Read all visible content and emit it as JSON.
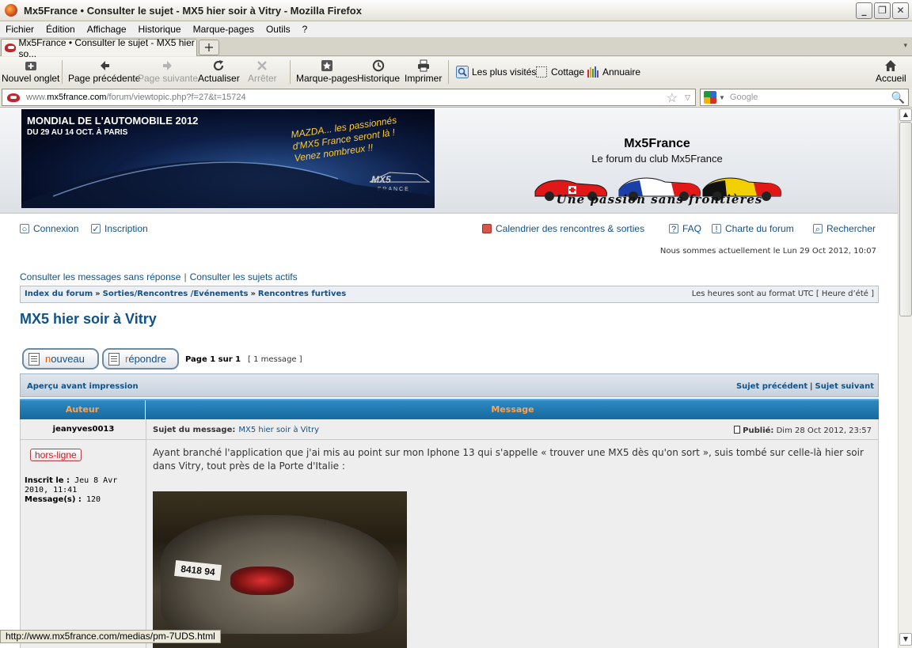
{
  "window": {
    "title": "Mx5France • Consulter le sujet - MX5 hier soir à Vitry - Mozilla Firefox",
    "min": "_",
    "max": "❐",
    "close": "✕"
  },
  "menu": [
    "Fichier",
    "Édition",
    "Affichage",
    "Historique",
    "Marque-pages",
    "Outils",
    "?"
  ],
  "tabs": {
    "active_title": "Mx5France • Consulter le sujet - MX5 hier so...",
    "new_tab": "+",
    "menu_arrow": "▾"
  },
  "toolbar": {
    "new_tab": "Nouvel onglet",
    "back": "Page précédente",
    "forward": "Page suivante",
    "reload": "Actualiser",
    "stop": "Arrêter",
    "bookmarks": "Marque-pages",
    "history": "Historique",
    "print": "Imprimer",
    "most_visited": "Les plus visités",
    "cottage": "Cottage",
    "directory": "Annuaire",
    "home": "Accueil"
  },
  "address": {
    "url_prefix": "www.",
    "domain": "mx5france.com",
    "path": "/forum/viewtopic.php?f=27&t=15724",
    "star": "☆",
    "drop": "▽"
  },
  "search": {
    "placeholder": "Google",
    "icon": "🔍"
  },
  "header": {
    "banner_title": "MONDIAL DE L'AUTOMOBILE 2012",
    "banner_dates": "DU 29 AU 14 OCT. À PARIS",
    "banner_message": "MAZDA... les passionnés d'MX5 France seront là ! Venez nombreux !!",
    "banner_logo": "MX5",
    "banner_logo_sub": "FRANCE",
    "site_name": "Mx5France",
    "site_desc": "Le forum du club Mx5France",
    "slogan": "Une passion sans frontières"
  },
  "nav": {
    "login": "Connexion",
    "register": "Inscription",
    "calendar": "Calendrier des rencontres & sorties",
    "faq": "FAQ",
    "charter": "Charte du forum",
    "search": "Rechercher"
  },
  "date_line": "Nous sommes actuellement le Lun 29 Oct 2012, 10:07",
  "quicklinks": {
    "unanswered": "Consulter les messages sans réponse",
    "separator": "|",
    "active": "Consulter les sujets actifs"
  },
  "breadcrumb": {
    "items": [
      "Index du forum",
      "Sorties/Rencontres /Evénements",
      "Rencontres furtives"
    ],
    "sep": "»",
    "timezone": "Les heures sont au format UTC [ Heure d’été ]"
  },
  "topic": {
    "title": "MX5 hier soir à Vitry",
    "new_btn_first": "n",
    "new_btn_rest": "ouveau",
    "reply_btn_first": "r",
    "reply_btn_rest": "épondre",
    "page_info": "Page 1 sur 1",
    "msg_count": "[ 1 message ]",
    "print_preview": "Aperçu avant impression",
    "prev_topic": "Sujet précédent",
    "bar": "|",
    "next_topic": "Sujet suivant"
  },
  "table": {
    "col_author": "Auteur",
    "col_message": "Message"
  },
  "post": {
    "author": "jeanyves0013",
    "status": "hors-ligne",
    "registered_label": "Inscrit le :",
    "registered_value": "Jeu 8 Avr 2010, 11:41",
    "messages_label": "Message(s) :",
    "messages_value": "120",
    "subject_label": "Sujet du message:",
    "subject": "MX5 hier soir à Vitry",
    "published_label": "Publié:",
    "published_value": "Dim 28 Oct 2012, 23:57",
    "body": "Ayant branché l'application que j'ai mis au point sur mon Iphone 13 qui s'appelle « trouver une MX5 dès qu'on sort », suis tombé sur celle-là hier soir dans Vitry, tout près de la Porte d'Italie :",
    "plate": "8418 94"
  },
  "status_url": "http://www.mx5france.com/medias/pm-7UDS.html",
  "scroll": {
    "up": "▲",
    "down": "▼"
  }
}
